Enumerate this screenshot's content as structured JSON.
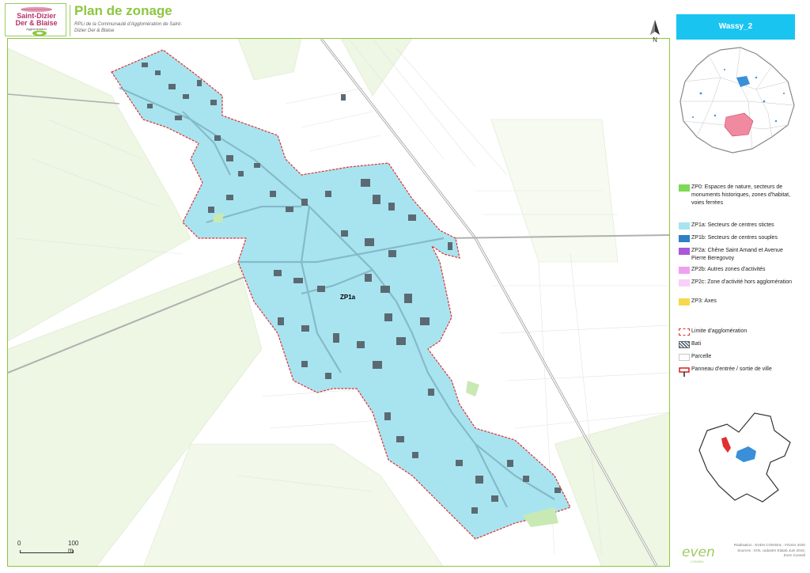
{
  "header": {
    "logo_line1": "Saint-Dizier",
    "logo_line2": "Der & Blaise",
    "logo_line3": "Agglomération",
    "title": "Plan de zonage",
    "subtitle": "RPLi de la Communauté d'Agglomération de Saint-Dizier Der & Blaise"
  },
  "map": {
    "zone_label": "ZP1a",
    "north_label": "N",
    "scale_start": "0",
    "scale_end": "100 m",
    "colors": {
      "zone_fill": "#a8e4f0",
      "zone_outline": "#e03030",
      "building": "#5b6a72",
      "field": "#eef6e4",
      "road": "#b8b8b8"
    }
  },
  "commune": {
    "name": "Wassy_2"
  },
  "legend": {
    "items": [
      {
        "label": "ZP0: Espaces de nature, secteurs de monuments historiques, zones d'habitat, voies ferrées",
        "color": "#7ed957"
      },
      {
        "label": "ZP1a: Secteurs de centres stictes",
        "color": "#a8e4f0"
      },
      {
        "label": "ZP1b: Secteurs de centres souples",
        "color": "#2e7fc8"
      },
      {
        "label": "ZP2a: Chêne Saint Amand et Avenue Pierre Beregovoy",
        "color": "#a958d8"
      },
      {
        "label": "ZP2b: Autres zones d'activités",
        "color": "#f0a0f0"
      },
      {
        "label": "ZP2c: Zone d'activité hors agglomération",
        "color": "#f8d0f8"
      },
      {
        "label": "ZP3: Axes",
        "color": "#f5d94a"
      },
      {
        "label": "Limite d'agglomération",
        "color": "#e03030"
      },
      {
        "label": "Bati",
        "color": "#5b6a72"
      },
      {
        "label": "Parcelle",
        "color": "#c8c8c8"
      },
      {
        "label": "Panneau d'entrée / sortie de ville",
        "color": "#d01010"
      }
    ]
  },
  "footer": {
    "credit_line1": "Réalisation : EVEN CONSEIL - Février 2020",
    "credit_line2": "Sources : IGN, cadastre Etalab Juin 2019,",
    "credit_line3": "Even Conseil",
    "even_logo": "even",
    "even_sub": "CONSEIL"
  }
}
